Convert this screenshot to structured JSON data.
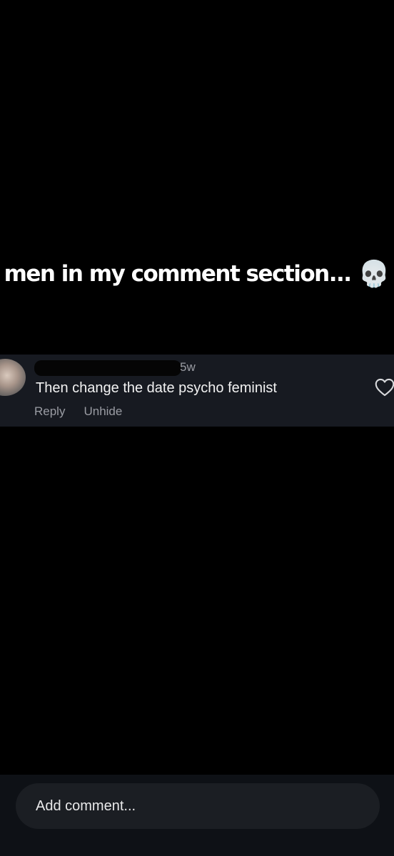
{
  "caption": {
    "text": "men in my comment section...",
    "emoji": "💀"
  },
  "comment": {
    "timestamp": "5w",
    "text": "Then change the date psycho feminist",
    "actions": {
      "reply": "Reply",
      "unhide": "Unhide"
    }
  },
  "composer": {
    "placeholder": "Add comment..."
  }
}
